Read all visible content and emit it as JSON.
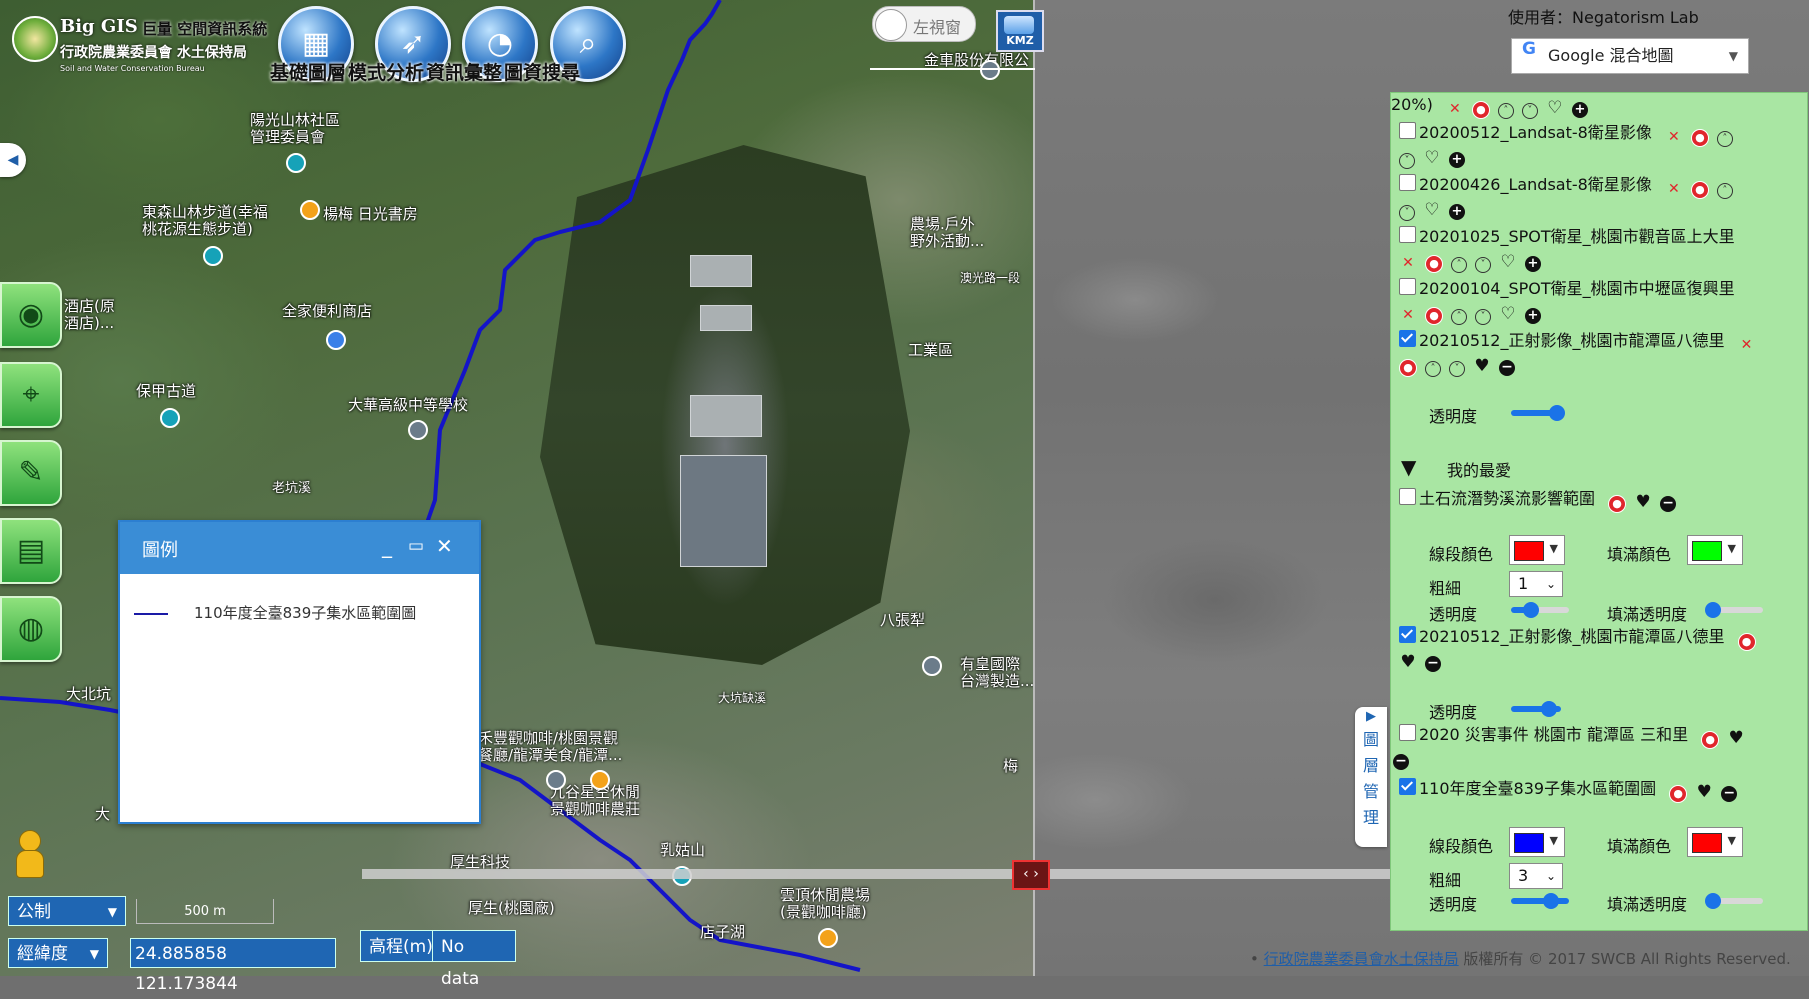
{
  "logo": {
    "brand": "Big GIS",
    "system": "巨量 空間資訊系統",
    "agency": "行政院農業委員會 水土保持局",
    "english": "Soil and Water Conservation Bureau"
  },
  "toolbar": {
    "items": [
      "基礎圖層",
      "模式分析",
      "資訊彙整",
      "圖資搜尋"
    ]
  },
  "compare_toggle": {
    "label": "左視窗"
  },
  "kmz": {
    "label": "KMZ"
  },
  "user": {
    "label": "使用者：Negatorism Lab"
  },
  "basemap": {
    "selected": "Google 混合地圖"
  },
  "map_labels": [
    "陽光山林社區\n管理委員會",
    "東森山林步道(幸福\n桃花源生態步道)",
    "楊梅 日光書房",
    "全家便利商店",
    "保甲古道",
    "大華高級中等學校",
    "老坑溪",
    "金車股份有限公",
    "農場.戶外\n野外活動...",
    "澳光路一段",
    "工業區",
    "八張犁",
    "有皇國際\n台灣製造...",
    "大坑缺溪",
    "禾豐觀咖啡/桃園景觀\n餐廳/龍潭美食/龍潭...",
    "大北坑",
    "九谷星空休閒\n景觀咖啡農莊",
    "乳姑山",
    "厚生科技",
    "厚生(桃園廠)",
    "雲頂休閒農場\n(景觀咖啡廳)",
    "店子湖",
    "梅",
    "大",
    "酒店(原\n酒店)..."
  ],
  "legend": {
    "title": "圖例",
    "entries": [
      {
        "label": "110年度全臺839子集水區範圍圖",
        "color": "#1a1aa6"
      }
    ]
  },
  "controls": {
    "unit": "公制",
    "scale": "500 m",
    "coord_mode": "經緯度",
    "coords": "24.885858 121.173844",
    "elevation_btn": "高程(m)",
    "elevation_value": "No data"
  },
  "layer_tab": {
    "label_chars": [
      "圖",
      "層",
      "管",
      "理"
    ]
  },
  "layer_panel": {
    "top_partial": "20%)",
    "layers": [
      {
        "name": "20200512_Landsat-8衛星影像",
        "checked": false
      },
      {
        "name": "20200426_Landsat-8衛星影像",
        "checked": false
      },
      {
        "name": "20201025_SPOT衛星_桃園市觀音區上大里",
        "checked": false
      },
      {
        "name": "20200104_SPOT衛星_桃園市中壢區復興里",
        "checked": false
      },
      {
        "name": "20210512_正射影像_桃園市龍潭區八德里",
        "checked": true
      }
    ],
    "opacity_label": "透明度",
    "favorites_title": "我的最愛",
    "favorites": [
      {
        "name": "土石流潛勢溪流影響範圍",
        "checked": false
      },
      {
        "name": "20210512_正射影像_桃園市龍潭區八德里",
        "checked": true
      },
      {
        "name": "2020 災害事件 桃園市 龍潭區 三和里",
        "checked": false
      },
      {
        "name": "110年度全臺839子集水區範圍圖",
        "checked": true
      }
    ],
    "style_labels": {
      "line_color": "線段顏色",
      "fill_color": "填滿顏色",
      "width": "粗細",
      "opacity": "透明度",
      "fill_opacity": "填滿透明度"
    },
    "debris_style": {
      "line_color": "#ff0000",
      "fill_color": "#00ff00",
      "width": "1",
      "opacity": 0.3,
      "fill_opacity": 0.0
    },
    "ortho_opacity": 0.65,
    "catchment_style": {
      "line_color": "#0000ff",
      "fill_color": "#ff0000",
      "width": "3",
      "opacity": 0.6,
      "fill_opacity": 0.0
    }
  },
  "copyright": {
    "agency": "行政院農業委員會水土保持局",
    "text": " 版權所有 © 2017 SWCB All Rights Reserved."
  }
}
